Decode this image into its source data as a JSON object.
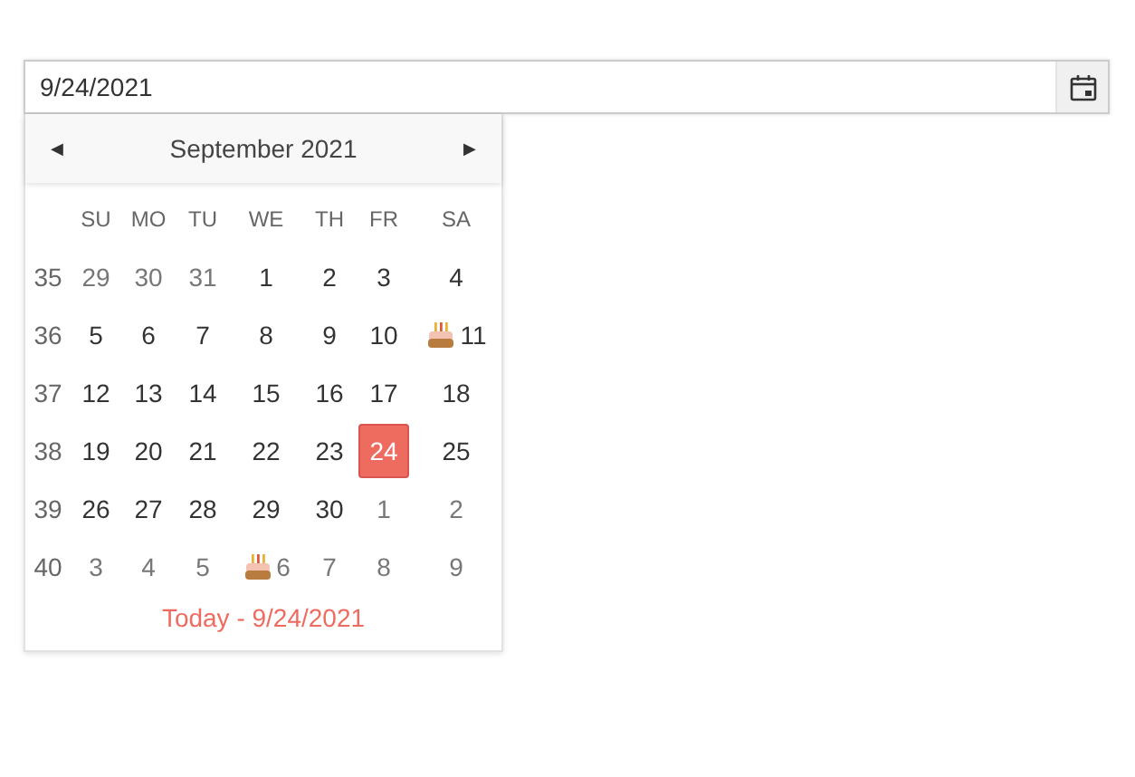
{
  "date_field": {
    "value": "9/24/2021"
  },
  "calendar": {
    "title": "September 2021",
    "prev": "◀",
    "next": "▶",
    "day_names": [
      "SU",
      "MO",
      "TU",
      "WE",
      "TH",
      "FR",
      "SA"
    ],
    "weeks": [
      {
        "number": "35",
        "days": [
          {
            "text": "29",
            "other_month": true,
            "selected": false,
            "birthday": false
          },
          {
            "text": "30",
            "other_month": true,
            "selected": false,
            "birthday": false
          },
          {
            "text": "31",
            "other_month": true,
            "selected": false,
            "birthday": false
          },
          {
            "text": "1",
            "other_month": false,
            "selected": false,
            "birthday": false
          },
          {
            "text": "2",
            "other_month": false,
            "selected": false,
            "birthday": false
          },
          {
            "text": "3",
            "other_month": false,
            "selected": false,
            "birthday": false
          },
          {
            "text": "4",
            "other_month": false,
            "selected": false,
            "birthday": false
          }
        ]
      },
      {
        "number": "36",
        "days": [
          {
            "text": "5",
            "other_month": false,
            "selected": false,
            "birthday": false
          },
          {
            "text": "6",
            "other_month": false,
            "selected": false,
            "birthday": false
          },
          {
            "text": "7",
            "other_month": false,
            "selected": false,
            "birthday": false
          },
          {
            "text": "8",
            "other_month": false,
            "selected": false,
            "birthday": false
          },
          {
            "text": "9",
            "other_month": false,
            "selected": false,
            "birthday": false
          },
          {
            "text": "10",
            "other_month": false,
            "selected": false,
            "birthday": false
          },
          {
            "text": "11",
            "other_month": false,
            "selected": false,
            "birthday": true
          }
        ]
      },
      {
        "number": "37",
        "days": [
          {
            "text": "12",
            "other_month": false,
            "selected": false,
            "birthday": false
          },
          {
            "text": "13",
            "other_month": false,
            "selected": false,
            "birthday": false
          },
          {
            "text": "14",
            "other_month": false,
            "selected": false,
            "birthday": false
          },
          {
            "text": "15",
            "other_month": false,
            "selected": false,
            "birthday": false
          },
          {
            "text": "16",
            "other_month": false,
            "selected": false,
            "birthday": false
          },
          {
            "text": "17",
            "other_month": false,
            "selected": false,
            "birthday": false
          },
          {
            "text": "18",
            "other_month": false,
            "selected": false,
            "birthday": false
          }
        ]
      },
      {
        "number": "38",
        "days": [
          {
            "text": "19",
            "other_month": false,
            "selected": false,
            "birthday": false
          },
          {
            "text": "20",
            "other_month": false,
            "selected": false,
            "birthday": false
          },
          {
            "text": "21",
            "other_month": false,
            "selected": false,
            "birthday": false
          },
          {
            "text": "22",
            "other_month": false,
            "selected": false,
            "birthday": false
          },
          {
            "text": "23",
            "other_month": false,
            "selected": false,
            "birthday": false
          },
          {
            "text": "24",
            "other_month": false,
            "selected": true,
            "birthday": false
          },
          {
            "text": "25",
            "other_month": false,
            "selected": false,
            "birthday": false
          }
        ]
      },
      {
        "number": "39",
        "days": [
          {
            "text": "26",
            "other_month": false,
            "selected": false,
            "birthday": false
          },
          {
            "text": "27",
            "other_month": false,
            "selected": false,
            "birthday": false
          },
          {
            "text": "28",
            "other_month": false,
            "selected": false,
            "birthday": false
          },
          {
            "text": "29",
            "other_month": false,
            "selected": false,
            "birthday": false
          },
          {
            "text": "30",
            "other_month": false,
            "selected": false,
            "birthday": false
          },
          {
            "text": "1",
            "other_month": true,
            "selected": false,
            "birthday": false
          },
          {
            "text": "2",
            "other_month": true,
            "selected": false,
            "birthday": false
          }
        ]
      },
      {
        "number": "40",
        "days": [
          {
            "text": "3",
            "other_month": true,
            "selected": false,
            "birthday": false
          },
          {
            "text": "4",
            "other_month": true,
            "selected": false,
            "birthday": false
          },
          {
            "text": "5",
            "other_month": true,
            "selected": false,
            "birthday": false
          },
          {
            "text": "6",
            "other_month": true,
            "selected": false,
            "birthday": true
          },
          {
            "text": "7",
            "other_month": true,
            "selected": false,
            "birthday": false
          },
          {
            "text": "8",
            "other_month": true,
            "selected": false,
            "birthday": false
          },
          {
            "text": "9",
            "other_month": true,
            "selected": false,
            "birthday": false
          }
        ]
      }
    ],
    "today_link": "Today - 9/24/2021"
  }
}
